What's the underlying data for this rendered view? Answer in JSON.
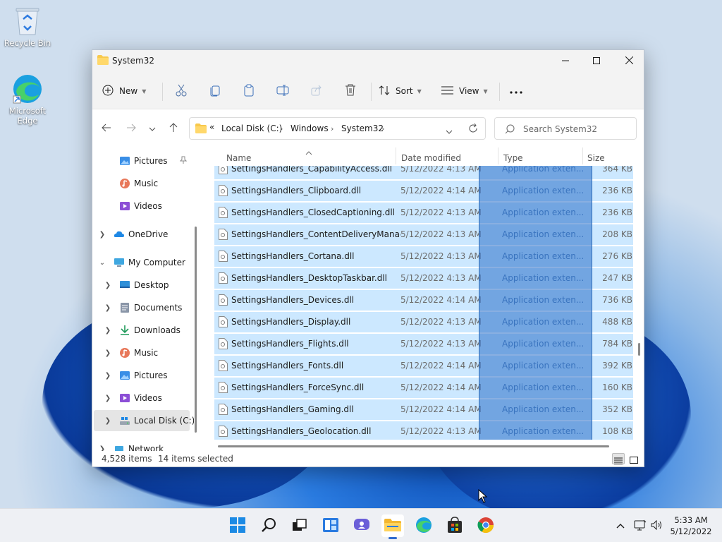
{
  "desktop": {
    "icons": [
      {
        "label": "Recycle Bin",
        "icon": "recycle-bin-icon"
      },
      {
        "label": "Microsoft Edge",
        "icon": "edge-icon"
      }
    ]
  },
  "window": {
    "title": "System32",
    "controls": {
      "minimize": "minimize-icon",
      "maximize": "maximize-icon",
      "close": "close-icon"
    }
  },
  "toolbar": {
    "new_label": "New",
    "sort_label": "Sort",
    "view_label": "View",
    "icons": [
      "cut-icon",
      "copy-icon",
      "paste-icon",
      "rename-icon",
      "share-icon",
      "delete-icon",
      "more-icon"
    ]
  },
  "address": {
    "overflow": "«",
    "crumbs": [
      "Local Disk (C:)",
      "Windows",
      "System32"
    ],
    "search_placeholder": "Search System32"
  },
  "nav": {
    "items": [
      {
        "label": "Pictures",
        "icon": "pictures-icon",
        "pinned": true
      },
      {
        "label": "Music",
        "icon": "music-icon"
      },
      {
        "label": "Videos",
        "icon": "videos-icon"
      },
      {
        "label": "OneDrive",
        "icon": "onedrive-icon"
      },
      {
        "label": "My Computer",
        "icon": "computer-icon"
      },
      {
        "label": "Desktop",
        "icon": "desktop-icon"
      },
      {
        "label": "Documents",
        "icon": "documents-icon"
      },
      {
        "label": "Downloads",
        "icon": "downloads-icon"
      },
      {
        "label": "Music",
        "icon": "music-icon"
      },
      {
        "label": "Pictures",
        "icon": "pictures-icon"
      },
      {
        "label": "Videos",
        "icon": "videos-icon"
      },
      {
        "label": "Local Disk (C:)",
        "icon": "local-disk-icon",
        "selected": true
      },
      {
        "label": "Network",
        "icon": "network-icon"
      }
    ]
  },
  "columns": {
    "name": "Name",
    "date": "Date modified",
    "type": "Type",
    "size": "Size"
  },
  "files": [
    {
      "name": "SettingsHandlers_CapabilityAccess.dll",
      "date": "5/12/2022 4:13 AM",
      "type": "Application exten...",
      "size": "364 KB"
    },
    {
      "name": "SettingsHandlers_Clipboard.dll",
      "date": "5/12/2022 4:14 AM",
      "type": "Application exten...",
      "size": "236 KB"
    },
    {
      "name": "SettingsHandlers_ClosedCaptioning.dll",
      "date": "5/12/2022 4:13 AM",
      "type": "Application exten...",
      "size": "236 KB"
    },
    {
      "name": "SettingsHandlers_ContentDeliveryManag...",
      "date": "5/12/2022 4:13 AM",
      "type": "Application exten...",
      "size": "208 KB"
    },
    {
      "name": "SettingsHandlers_Cortana.dll",
      "date": "5/12/2022 4:13 AM",
      "type": "Application exten...",
      "size": "276 KB"
    },
    {
      "name": "SettingsHandlers_DesktopTaskbar.dll",
      "date": "5/12/2022 4:13 AM",
      "type": "Application exten...",
      "size": "247 KB"
    },
    {
      "name": "SettingsHandlers_Devices.dll",
      "date": "5/12/2022 4:14 AM",
      "type": "Application exten...",
      "size": "736 KB"
    },
    {
      "name": "SettingsHandlers_Display.dll",
      "date": "5/12/2022 4:13 AM",
      "type": "Application exten...",
      "size": "488 KB"
    },
    {
      "name": "SettingsHandlers_Flights.dll",
      "date": "5/12/2022 4:13 AM",
      "type": "Application exten...",
      "size": "784 KB"
    },
    {
      "name": "SettingsHandlers_Fonts.dll",
      "date": "5/12/2022 4:14 AM",
      "type": "Application exten...",
      "size": "392 KB"
    },
    {
      "name": "SettingsHandlers_ForceSync.dll",
      "date": "5/12/2022 4:14 AM",
      "type": "Application exten...",
      "size": "160 KB"
    },
    {
      "name": "SettingsHandlers_Gaming.dll",
      "date": "5/12/2022 4:14 AM",
      "type": "Application exten...",
      "size": "352 KB"
    },
    {
      "name": "SettingsHandlers_Geolocation.dll",
      "date": "5/12/2022 4:13 AM",
      "type": "Application exten...",
      "size": "108 KB"
    }
  ],
  "status": {
    "item_count": "4,528 items",
    "selected": "14 items selected"
  },
  "taskbar": {
    "icons": [
      "start-icon",
      "search-icon",
      "task-view-icon",
      "widgets-icon",
      "chat-icon",
      "file-explorer-icon",
      "edge-icon",
      "store-icon",
      "chrome-icon"
    ],
    "tray_icons": [
      "chevron-up-icon",
      "network-icon",
      "volume-icon"
    ],
    "time": "5:33 AM",
    "date": "5/12/2022"
  },
  "colors": {
    "selection": "#cce8ff",
    "accent": "#0067c0",
    "type_column_highlight": "#2d6cb8"
  }
}
